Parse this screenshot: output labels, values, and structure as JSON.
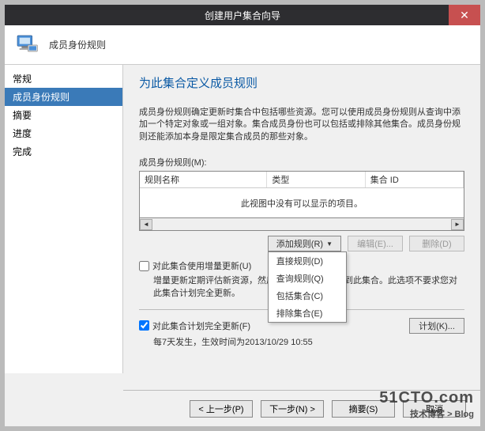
{
  "window": {
    "title": "创建用户集合向导",
    "header_title": "成员身份规则"
  },
  "sidebar": {
    "items": [
      {
        "label": "常规"
      },
      {
        "label": "成员身份规则"
      },
      {
        "label": "摘要"
      },
      {
        "label": "进度"
      },
      {
        "label": "完成"
      }
    ],
    "active_index": 1
  },
  "content": {
    "heading": "为此集合定义成员规则",
    "description": "成员身份规则确定更新时集合中包括哪些资源。您可以使用成员身份规则从查询中添加一个特定对象或一组对象。集合成员身份也可以包括或排除其他集合。成员身份规则还能添加本身是限定集合成员的那些对象。",
    "rules_label": "成员身份规则(M):",
    "table": {
      "col_name": "规则名称",
      "col_type": "类型",
      "col_id": "集合 ID",
      "empty_msg": "此视图中没有可以显示的项目。"
    },
    "buttons": {
      "add_rule": "添加规则(R)",
      "edit": "编辑(E)...",
      "delete": "删除(D)"
    },
    "dropdown": {
      "items": [
        {
          "label": "直接规则(D)"
        },
        {
          "label": "查询规则(Q)"
        },
        {
          "label": "包括集合(C)"
        },
        {
          "label": "排除集合(E)"
        }
      ]
    },
    "incremental": {
      "checkbox_label": "对此集合使用增量更新(U)",
      "hint": "增量更新定期评估新资源，然后将合格的资源添加到此集合。此选项不要求您对此集合计划完全更新。"
    },
    "full_update": {
      "checkbox_label": "对此集合计划完全更新(F)",
      "schedule_text": "每7天发生，生效时间为2013/10/29 10:55",
      "schedule_button": "计划(K)..."
    }
  },
  "footer": {
    "prev": "< 上一步(P)",
    "next": "下一步(N) >",
    "summary": "摘要(S)",
    "cancel": "取消"
  },
  "watermark": {
    "line1": "51CTO.com",
    "line2": "技术博客 > Blog"
  }
}
